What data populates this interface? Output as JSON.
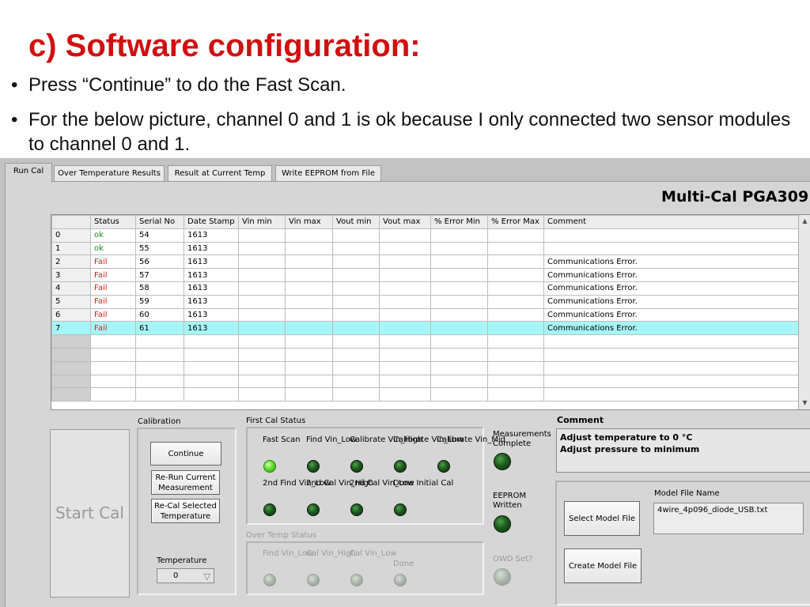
{
  "slide": {
    "title": "c) Software configuration:",
    "bullets": [
      "Press “Continue” to do the Fast Scan.",
      "For the below picture, channel 0 and 1 is ok because I only connected two sensor modules to channel 0 and 1."
    ]
  },
  "app": {
    "title": "Multi-Cal PGA309",
    "tabs": [
      "Run Cal",
      "Over Temperature Results",
      "Result at Current Temp",
      "Write EEPROM from File"
    ],
    "active_tab": "Run Cal",
    "table": {
      "columns": [
        "",
        "Status",
        "Serial No",
        "Date Stamp",
        "Vin min",
        "Vin max",
        "Vout min",
        "Vout max",
        "% Error Min",
        "% Error Max",
        "Comment"
      ],
      "rows": [
        {
          "idx": "0",
          "status": "ok",
          "serial": "54",
          "date": "1613",
          "comment": ""
        },
        {
          "idx": "1",
          "status": "ok",
          "serial": "55",
          "date": "1613",
          "comment": ""
        },
        {
          "idx": "2",
          "status": "Fail",
          "serial": "56",
          "date": "1613",
          "comment": "Communications Error."
        },
        {
          "idx": "3",
          "status": "Fail",
          "serial": "57",
          "date": "1613",
          "comment": "Communications Error."
        },
        {
          "idx": "4",
          "status": "Fail",
          "serial": "58",
          "date": "1613",
          "comment": "Communications Error."
        },
        {
          "idx": "5",
          "status": "Fail",
          "serial": "59",
          "date": "1613",
          "comment": "Communications Error."
        },
        {
          "idx": "6",
          "status": "Fail",
          "serial": "60",
          "date": "1613",
          "comment": "Communications Error."
        },
        {
          "idx": "7",
          "status": "Fail",
          "serial": "61",
          "date": "1613",
          "comment": "Communications Error."
        }
      ],
      "selected_row": "7",
      "status_colors": {
        "ok": "#1b8b1b",
        "Fail": "#e02020"
      }
    },
    "start_cal_label": "Start Cal",
    "calibration": {
      "label": "Calibration",
      "continue": "Continue",
      "rerun": "Re-Run Current Measurement",
      "recal": "Re-Cal Selected Temperature",
      "temperature_label": "Temperature",
      "temperature_value": "0"
    },
    "first_cal_status": {
      "label": "First Cal Status",
      "row1": [
        {
          "label": "Fast Scan",
          "on": true
        },
        {
          "label": "Find Vin_Low",
          "on": false
        },
        {
          "label": "Calibrate Vin_High",
          "on": false
        },
        {
          "label": "Calibrate Vin_Low",
          "on": false
        },
        {
          "label": "Calibrate Vin_Mid",
          "on": false
        }
      ],
      "row2": [
        {
          "label": "2nd Find Vin_Low",
          "on": false
        },
        {
          "label": "2nd Cal Vin_High",
          "on": false
        },
        {
          "label": "2nd Cal Vin_Low",
          "on": false
        },
        {
          "label": "Done Initial Cal",
          "on": false
        }
      ]
    },
    "over_temp_status": {
      "label": "Over Temp Status",
      "items": [
        "Find Vin_Low",
        "Cal Vin_High",
        "Cal Vin_Low",
        "Done"
      ]
    },
    "indicators": {
      "measurements_complete": "Measurements Complete",
      "eeprom_written": "EEPROM Written",
      "owd_set": "OWD Set?"
    },
    "comment": {
      "label": "Comment",
      "line1": "Adjust temperature to 0 °C",
      "line2": "Adjust pressure to minimum"
    },
    "model": {
      "select_button": "Select Model File",
      "create_button": "Create Model File",
      "file_label": "Model File Name",
      "file_value": "4wire_4p096_diode_USB.txt"
    }
  }
}
